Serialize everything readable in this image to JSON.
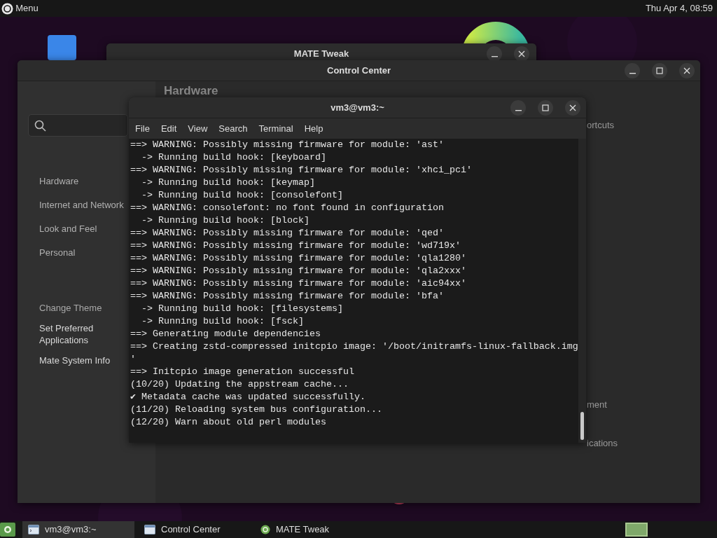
{
  "top_panel": {
    "menu_label": "Menu",
    "clock": "Thu Apr  4, 08:59"
  },
  "mate_tweak": {
    "title": "MATE Tweak"
  },
  "control_center": {
    "title": "Control Center",
    "heading": "Hardware",
    "categories": [
      "Hardware",
      "Internet and Network",
      "Look and Feel",
      "Personal"
    ],
    "items": [
      "Change Theme",
      "Set Preferred Applications",
      "Mate System Info"
    ],
    "content_fragments": [
      "ortcuts",
      "ment",
      "ications"
    ]
  },
  "terminal": {
    "title": "vm3@vm3:~",
    "menu": [
      "File",
      "Edit",
      "View",
      "Search",
      "Terminal",
      "Help"
    ],
    "lines": [
      "==> WARNING: Possibly missing firmware for module: 'ast'",
      "  -> Running build hook: [keyboard]",
      "==> WARNING: Possibly missing firmware for module: 'xhci_pci'",
      "  -> Running build hook: [keymap]",
      "  -> Running build hook: [consolefont]",
      "==> WARNING: consolefont: no font found in configuration",
      "  -> Running build hook: [block]",
      "==> WARNING: Possibly missing firmware for module: 'qed'",
      "==> WARNING: Possibly missing firmware for module: 'wd719x'",
      "==> WARNING: Possibly missing firmware for module: 'qla1280'",
      "==> WARNING: Possibly missing firmware for module: 'qla2xxx'",
      "==> WARNING: Possibly missing firmware for module: 'aic94xx'",
      "==> WARNING: Possibly missing firmware for module: 'bfa'",
      "  -> Running build hook: [filesystems]",
      "  -> Running build hook: [fsck]",
      "==> Generating module dependencies",
      "==> Creating zstd-compressed initcpio image: '/boot/initramfs-linux-fallback.img",
      "'",
      "==> Initcpio image generation successful",
      "(10/20) Updating the appstream cache...",
      "✔ Metadata cache was updated successfully.",
      "(11/20) Reloading system bus configuration...",
      "(12/20) Warn about old perl modules"
    ]
  },
  "taskbar": {
    "tasks": [
      {
        "label": "vm3@vm3:~",
        "kind": "terminal",
        "selected": true
      },
      {
        "label": "Control Center",
        "kind": "window",
        "selected": false
      },
      {
        "label": "MATE Tweak",
        "kind": "tweak",
        "selected": false
      }
    ]
  }
}
